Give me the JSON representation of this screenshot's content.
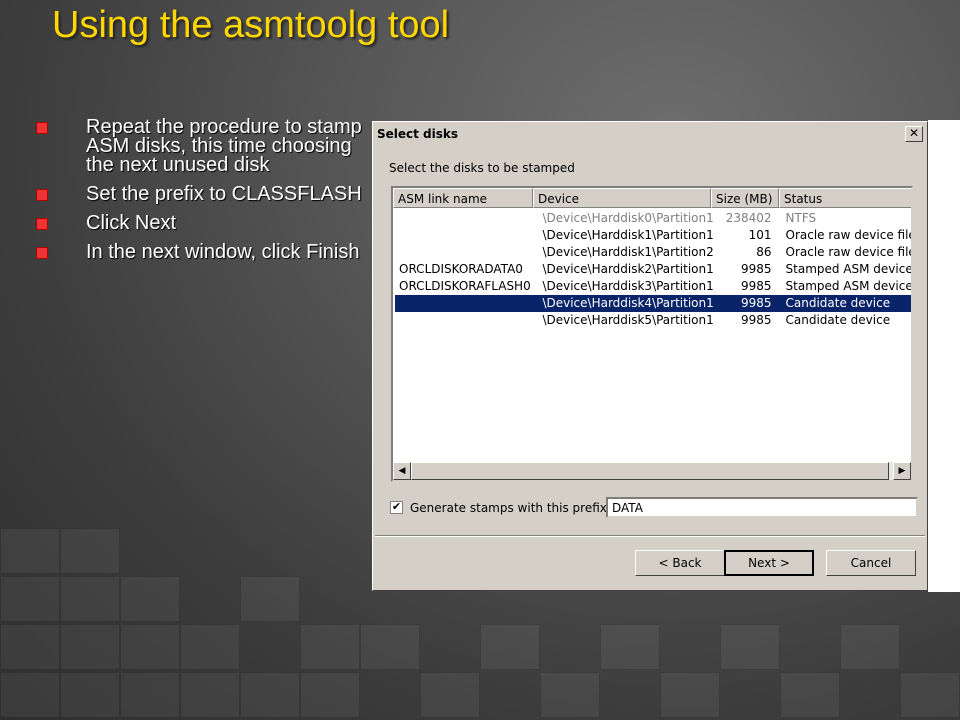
{
  "slide": {
    "title": "Using the asmtoolg tool",
    "bullets": [
      "Repeat the procedure to stamp ASM disks, this time choosing the next unused disk",
      "Set the prefix to CLASSFLASH",
      "Click Next",
      "In the next window, click Finish"
    ]
  },
  "dialog": {
    "title": "Select disks",
    "close_glyph": "✕",
    "instruction": "Select the disks to be stamped",
    "columns": [
      "ASM link name",
      "Device",
      "Size (MB)",
      "Status"
    ],
    "rows": [
      {
        "asm": "",
        "device": "\\Device\\Harddisk0\\Partition1",
        "size": "238402",
        "status": "NTFS"
      },
      {
        "asm": "",
        "device": "\\Device\\Harddisk1\\Partition1",
        "size": "101",
        "status": "Oracle raw device file"
      },
      {
        "asm": "",
        "device": "\\Device\\Harddisk1\\Partition2",
        "size": "86",
        "status": "Oracle raw device file"
      },
      {
        "asm": "ORCLDISKORADATA0",
        "device": "\\Device\\Harddisk2\\Partition1",
        "size": "9985",
        "status": "Stamped ASM device"
      },
      {
        "asm": "ORCLDISKORAFLASH0",
        "device": "\\Device\\Harddisk3\\Partition1",
        "size": "9985",
        "status": "Stamped ASM device"
      },
      {
        "asm": "",
        "device": "\\Device\\Harddisk4\\Partition1",
        "size": "9985",
        "status": "Candidate device"
      },
      {
        "asm": "",
        "device": "\\Device\\Harddisk5\\Partition1",
        "size": "9985",
        "status": "Candidate device"
      }
    ],
    "checkbox_label": "Generate stamps with this prefix",
    "checkbox_checked": true,
    "check_glyph": "✔",
    "prefix_value": "DATA",
    "buttons": {
      "back": "< Back",
      "next": "Next >",
      "cancel": "Cancel"
    },
    "scroll_left": "◀",
    "scroll_right": "▶"
  },
  "colors": {
    "title": "#ffd700",
    "bullet": "#e33333",
    "selection": "#0a246a",
    "dialog_face": "#d4d0c8"
  }
}
